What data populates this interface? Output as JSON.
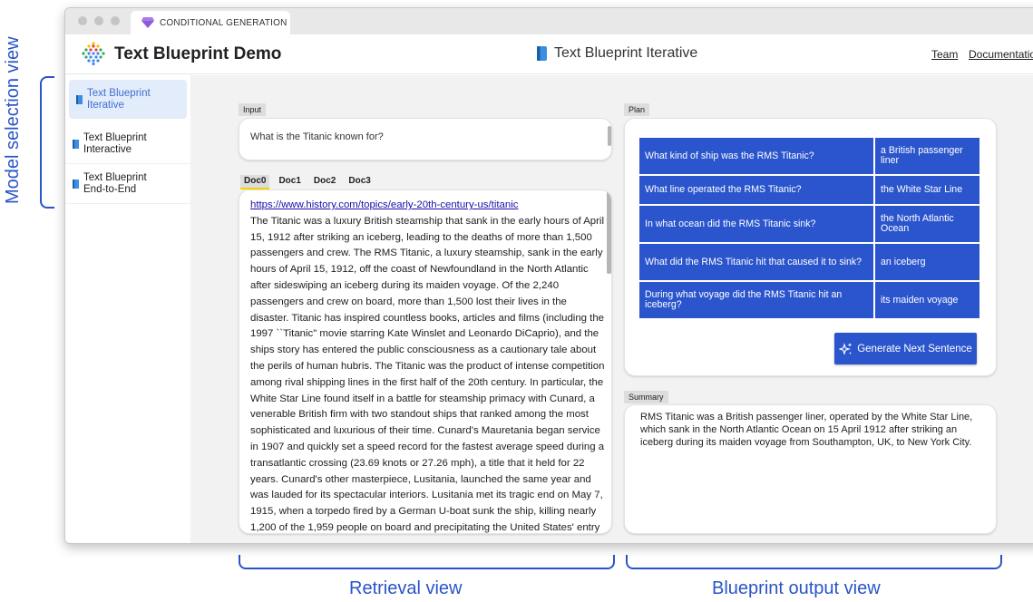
{
  "annotations": {
    "left": "Model selection view",
    "retrieval": "Retrieval view",
    "blueprint": "Blueprint output view"
  },
  "window": {
    "tab_title": "CONDITIONAL GENERATION"
  },
  "appbar": {
    "title": "Text Blueprint Demo",
    "center_title": "Text Blueprint Iterative",
    "links": [
      "Team",
      "Documentation"
    ]
  },
  "sidebar": {
    "items": [
      {
        "line1": "Text Blueprint",
        "line2": "Iterative"
      },
      {
        "line1": "Text Blueprint",
        "line2": "Interactive"
      },
      {
        "line1": "Text Blueprint",
        "line2": "End-to-End"
      }
    ]
  },
  "input": {
    "label": "Input",
    "text": "What is the Titanic known for?"
  },
  "docs": {
    "tabs": [
      "Doc0",
      "Doc1",
      "Doc2",
      "Doc3"
    ],
    "url": "https://www.history.com/topics/early-20th-century-us/titanic",
    "body": "The Titanic was a luxury British steamship that sank in the early hours of April 15, 1912 after striking an iceberg, leading to the deaths of more than 1,500 passengers and crew. The RMS Titanic, a luxury steamship, sank in the early hours of April 15, 1912, off the coast of Newfoundland in the North Atlantic after sideswiping an iceberg during its maiden voyage. Of the 2,240 passengers and crew on board, more than 1,500 lost their lives in the disaster. Titanic has inspired countless books, articles and films (including the 1997 ``Titanic\" movie starring Kate Winslet and Leonardo DiCaprio), and the ships story has entered the public consciousness as a cautionary tale about the perils of human hubris. The Titanic was the product of intense competition among rival shipping lines in the first half of the 20th century. In particular, the White Star Line found itself in a battle for steamship primacy with Cunard, a venerable British firm with two standout ships that ranked among the most sophisticated and luxurious of their time. Cunard's Mauretania began service in 1907 and quickly set a speed record for the fastest average speed during a transatlantic crossing (23.69 knots or 27.26 mph), a title that it held for 22 years. Cunard's other masterpiece, Lusitania, launched the same year and was lauded for its spectacular interiors. Lusitania met its tragic end on May 7, 1915, when a torpedo fired by a German U-boat sunk the ship, killing nearly 1,200 of the 1,959 people on board and precipitating the United States' entry into World War I. Did you"
  },
  "plan": {
    "label": "Plan",
    "rows": [
      {
        "q": "What kind of ship was the RMS Titanic?",
        "a": "a British passenger liner"
      },
      {
        "q": "What line operated the RMS Titanic?",
        "a": "the White Star Line"
      },
      {
        "q": "In what ocean did the RMS Titanic sink?",
        "a": "the North Atlantic Ocean"
      },
      {
        "q": "What did the RMS Titanic hit that caused it to sink?",
        "a": "an iceberg"
      },
      {
        "q": "During what voyage did the RMS Titanic hit an iceberg?",
        "a": "its maiden voyage"
      }
    ],
    "button_label": "Generate Next Sentence"
  },
  "summary": {
    "label": "Summary",
    "text": "RMS Titanic was a British passenger liner, operated by the White Star Line, which sank in the North Atlantic Ocean on 15 April 1912 after striking an iceberg during its maiden voyage from Southampton, UK, to New York City."
  },
  "colors": {
    "accent": "#2b55cc",
    "annotation": "#2a55c8",
    "active_tab_underline": "#f2d400"
  }
}
